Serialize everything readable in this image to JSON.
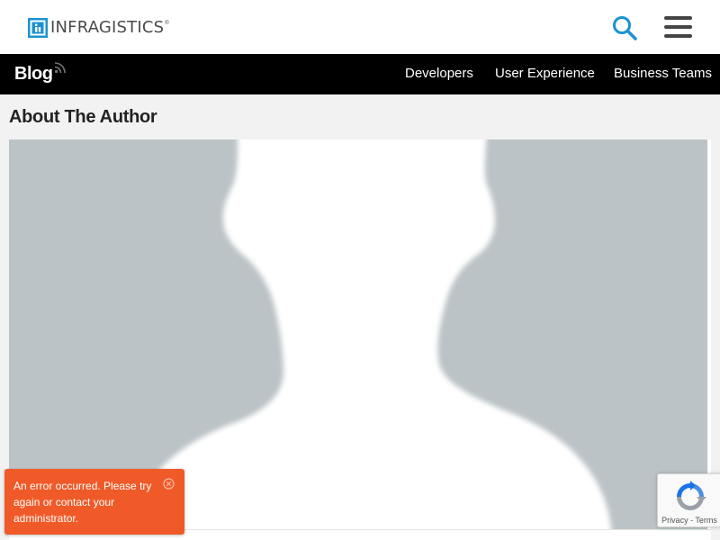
{
  "header": {
    "logo_text": "INFRAGISTICS",
    "logo_reg": "®",
    "search_icon": "search-icon",
    "menu_icon": "hamburger-menu-icon",
    "accent_color": "#1c92d2"
  },
  "nav": {
    "blog_label": "Blog",
    "rss_icon": "rss-icon",
    "items": [
      {
        "label": "Developers"
      },
      {
        "label": "User Experience"
      },
      {
        "label": "Business Teams"
      }
    ]
  },
  "main": {
    "heading": "About The Author",
    "photo_icon": "default-avatar-silhouette",
    "photo_bg_color": "#bcc3c6"
  },
  "toast": {
    "message": "An error occurred. Please try again or contact your administrator.",
    "close_icon": "close-circle-icon",
    "color": "#f05a28"
  },
  "recaptcha": {
    "logo_icon": "recaptcha-icon",
    "privacy_label": "Privacy",
    "separator": " - ",
    "terms_label": "Terms"
  }
}
